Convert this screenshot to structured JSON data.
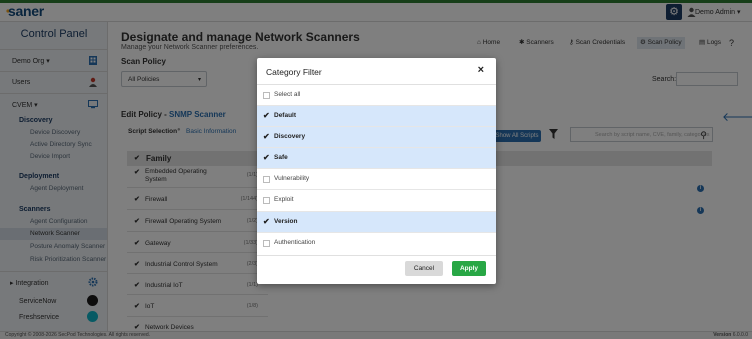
{
  "header": {
    "logo": "saner",
    "user": "Demo Admin"
  },
  "sidebar": {
    "title": "Control Panel",
    "org": "Demo Org",
    "users": "Users",
    "module": "CVEM",
    "groups": [
      {
        "title": "Discovery",
        "items": [
          "Device Discovery",
          "Active Directory Sync",
          "Device Import"
        ]
      },
      {
        "title": "Deployment",
        "items": [
          "Agent Deployment"
        ]
      },
      {
        "title": "Scanners",
        "items": [
          "Agent Configuration",
          "Network Scanner",
          "Posture Anomaly Scanner",
          "Risk Prioritization Scanner"
        ]
      }
    ],
    "integration": "Integration",
    "integrations": [
      "ServiceNow",
      "Freshservice"
    ]
  },
  "page": {
    "title": "Designate and manage Network Scanners",
    "subtitle": "Manage your Network Scanner preferences.",
    "nav": [
      "Home",
      "Scanners",
      "Scan Credentials",
      "Scan Policy",
      "Logs"
    ],
    "scan_policy_label": "Scan Policy",
    "policy_select": "All Policies",
    "search_label": "Search:",
    "edit_policy_label": "Edit Policy -",
    "edit_policy_name": "SNMP Scanner",
    "step1": "Script Selection",
    "step2": "Basic Information",
    "family_header": "Family",
    "families": [
      {
        "name": "Embedded Operating System",
        "count": "(1/1)"
      },
      {
        "name": "Firewall",
        "count": "(1/144)"
      },
      {
        "name": "Firewall Operating System",
        "count": "(1/2)"
      },
      {
        "name": "Gateway",
        "count": "(1/33)"
      },
      {
        "name": "Industrial Control System",
        "count": "(2/3)"
      },
      {
        "name": "Industrial IoT",
        "count": "(1/1)"
      },
      {
        "name": "IoT",
        "count": "(1/8)"
      },
      {
        "name": "Network Devices",
        "count": ""
      }
    ],
    "show_all_scripts": "Show All Scripts",
    "script_search_placeholder": "Search by script name, CVE, family, categories"
  },
  "modal": {
    "title": "Category Filter",
    "close": "×",
    "select_all": "Select all",
    "categories": [
      {
        "label": "Default",
        "checked": true
      },
      {
        "label": "Discovery",
        "checked": true
      },
      {
        "label": "Safe",
        "checked": true
      },
      {
        "label": "Vulnerability",
        "checked": false
      },
      {
        "label": "Exploit",
        "checked": false
      },
      {
        "label": "Version",
        "checked": true
      },
      {
        "label": "Authentication",
        "checked": false
      }
    ],
    "cancel": "Cancel",
    "apply": "Apply"
  },
  "footer": {
    "copyright": "Copyright © 2008-2026 SecPod Technologies. All rights reserved.",
    "version_label": "Version",
    "version": "6.0.0.0"
  },
  "colors": {
    "brand_navy": "#1c3c64",
    "accent_blue": "#2a6fb0",
    "apply_green": "#28a745",
    "selected_row": "#d6e7fb"
  }
}
